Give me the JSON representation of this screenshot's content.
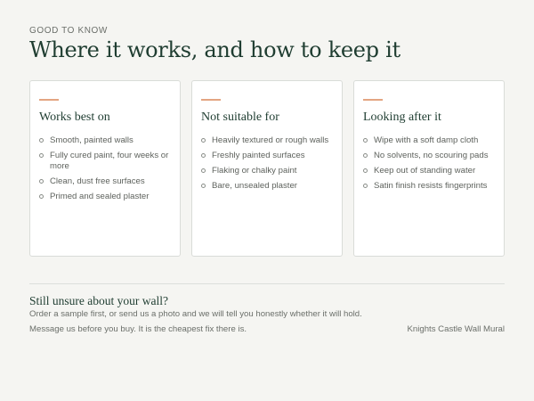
{
  "eyebrow": "GOOD TO KNOW",
  "headline": "Where it works, and how to keep it",
  "cards": [
    {
      "title": "Works best on",
      "items": [
        "Smooth, painted walls",
        "Fully cured paint, four weeks or more",
        "Clean, dust free surfaces",
        "Primed and sealed plaster"
      ]
    },
    {
      "title": "Not suitable for",
      "items": [
        "Heavily textured or rough walls",
        "Freshly painted surfaces",
        "Flaking or chalky paint",
        "Bare, unsealed plaster"
      ]
    },
    {
      "title": "Looking after it",
      "items": [
        "Wipe with a soft damp cloth",
        "No solvents, no scouring pads",
        "Keep out of standing water",
        "Satin finish resists fingerprints"
      ]
    }
  ],
  "cta": {
    "title": "Still unsure about your wall?",
    "body": "Order a sample first, or send us a photo and we will tell you honestly whether it will hold.",
    "note": "Message us before you buy. It is the cheapest fix there is."
  },
  "product_name": "Knights Castle Wall Mural",
  "colors": {
    "accent": "#e3a582",
    "heading": "#1f3d31",
    "background": "#f5f5f2"
  }
}
